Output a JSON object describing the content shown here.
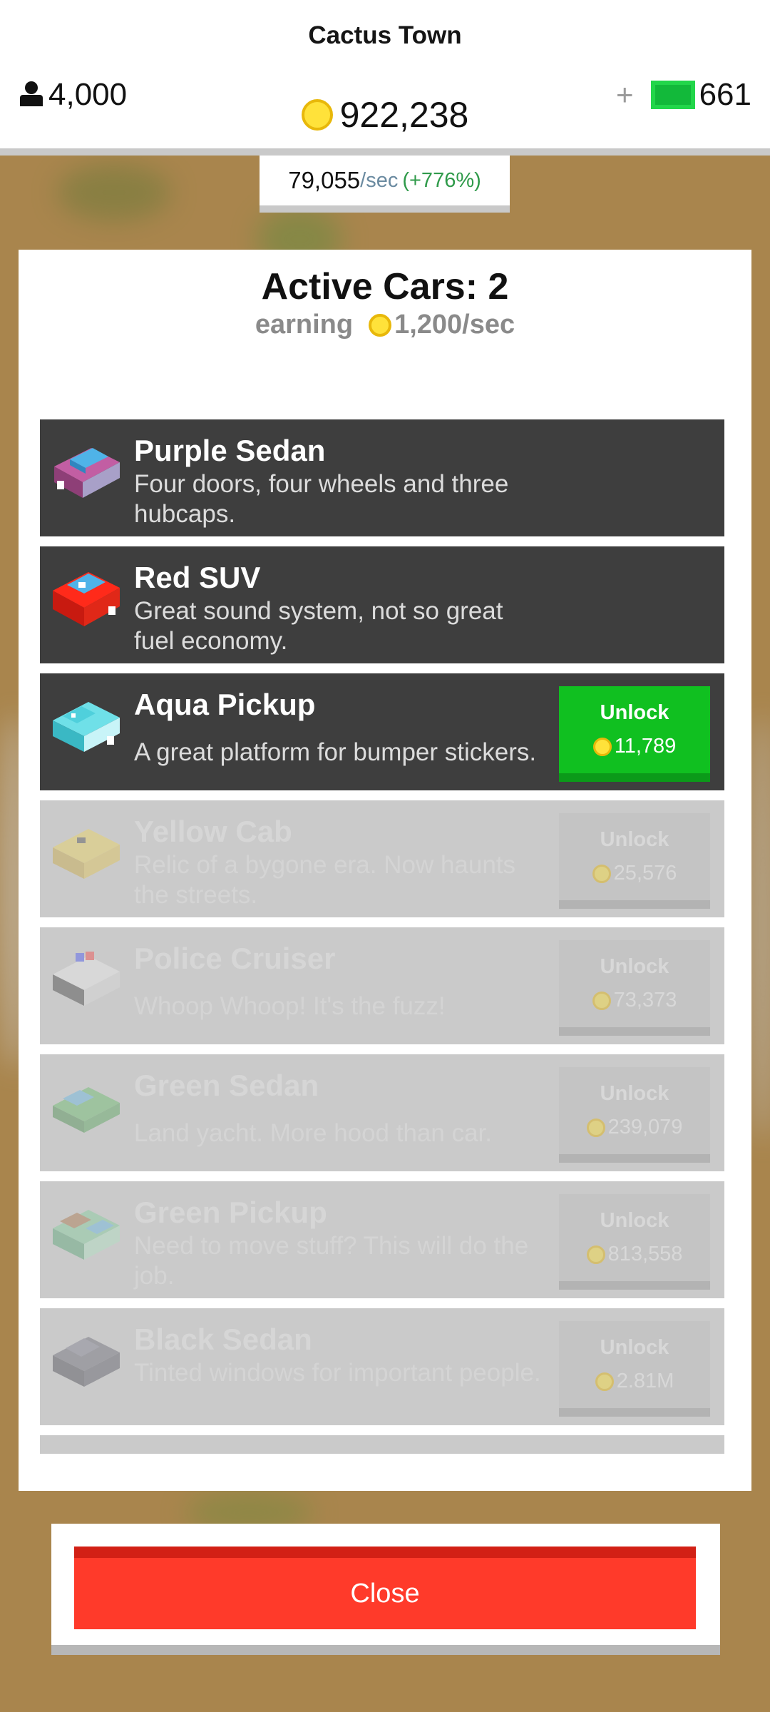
{
  "header": {
    "town_name": "Cactus Town",
    "population": "4,000",
    "coins": "922,238",
    "plus": "+",
    "cash": "661",
    "rate_value": "79,055",
    "rate_unit": "/sec",
    "rate_pct": "(+776%)",
    "icons": [
      "person-icon",
      "coin-icon",
      "cash-icon"
    ]
  },
  "panel": {
    "title": "Active Cars: 2",
    "earning_label": "earning",
    "earning_rate": "1,200/sec"
  },
  "cars": [
    {
      "name": "Purple Sedan",
      "desc": "Four doors, four wheels and three hubcaps.",
      "state": "owned"
    },
    {
      "name": "Red SUV",
      "desc": "Great sound system, not so great fuel economy.",
      "state": "owned"
    },
    {
      "name": "Aqua Pickup",
      "desc": "A great platform for bumper stickers.",
      "state": "available",
      "unlock_label": "Unlock",
      "price": "11,789"
    },
    {
      "name": "Yellow Cab",
      "desc": "Relic of a bygone era. Now haunts the streets.",
      "state": "locked",
      "unlock_label": "Unlock",
      "price": "25,576"
    },
    {
      "name": "Police Cruiser",
      "desc": "Whoop Whoop! It's the fuzz!",
      "state": "locked",
      "unlock_label": "Unlock",
      "price": "73,373"
    },
    {
      "name": "Green Sedan",
      "desc": "Land yacht. More hood than car.",
      "state": "locked",
      "unlock_label": "Unlock",
      "price": "239,079"
    },
    {
      "name": "Green Pickup",
      "desc": "Need to move stuff? This will do the job.",
      "state": "locked",
      "unlock_label": "Unlock",
      "price": "813,558"
    },
    {
      "name": "Black Sedan",
      "desc": "Tinted windows for important people.",
      "state": "locked",
      "unlock_label": "Unlock",
      "price": "2.81M"
    }
  ],
  "footer": {
    "close_label": "Close"
  },
  "colors": {
    "unlock_green": "#10c020",
    "close_red": "#ff3a2a",
    "coin_yellow": "#ffe23a"
  }
}
